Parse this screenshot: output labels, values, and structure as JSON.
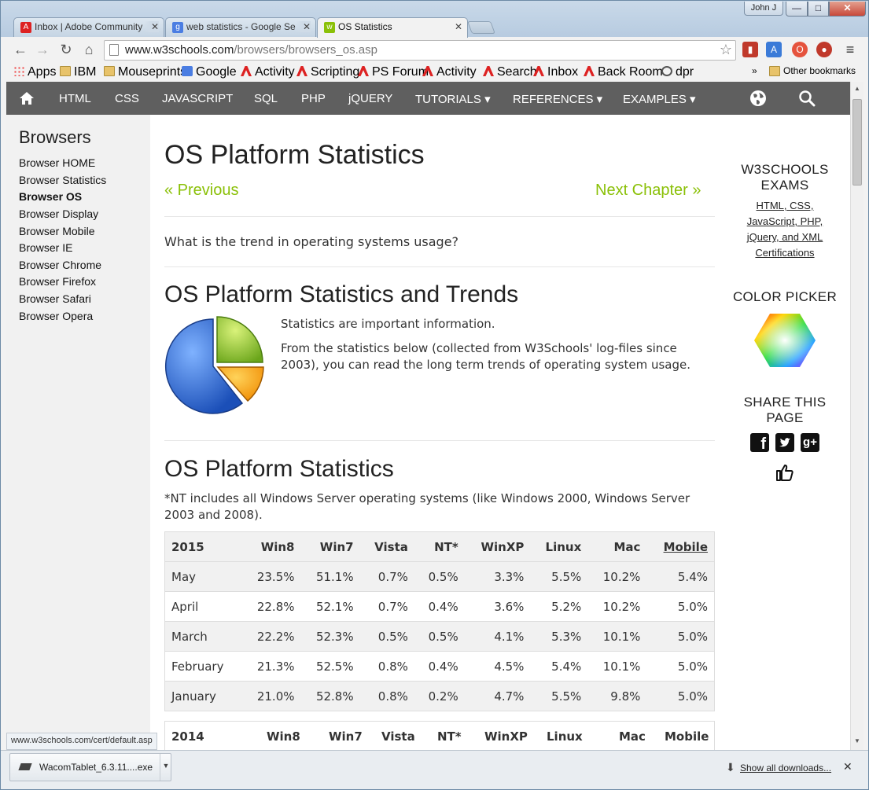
{
  "window": {
    "user": "John J",
    "min": "—",
    "max": "□",
    "close": "✕"
  },
  "tabs": [
    {
      "title": "Inbox | Adobe Community",
      "icon": "adobe-icon"
    },
    {
      "title": "web statistics - Google Se",
      "icon": "google-icon"
    },
    {
      "title": "OS Statistics",
      "icon": "w3schools-icon"
    }
  ],
  "address": {
    "host": "www.w3schools.com",
    "path": "/browsers/browsers_os.asp"
  },
  "bookmarks": [
    {
      "label": "Apps",
      "icon": "apps"
    },
    {
      "label": "IBM",
      "icon": "folder"
    },
    {
      "label": "Mouseprints",
      "icon": "folder"
    },
    {
      "label": "Google",
      "icon": "goog"
    },
    {
      "label": "Activity",
      "icon": "adobe"
    },
    {
      "label": "Scripting",
      "icon": "adobe"
    },
    {
      "label": "PS Forum",
      "icon": "adobe"
    },
    {
      "label": "Activity",
      "icon": "adobe"
    },
    {
      "label": "Search",
      "icon": "adobe"
    },
    {
      "label": "Inbox",
      "icon": "adobe"
    },
    {
      "label": "Back Room",
      "icon": "adobe"
    },
    {
      "label": "dpr",
      "icon": "dpr"
    }
  ],
  "bookmarks_more": "»",
  "other_bookmarks": "Other bookmarks",
  "nav": {
    "items": [
      "HTML",
      "CSS",
      "JAVASCRIPT",
      "SQL",
      "PHP",
      "jQUERY",
      "TUTORIALS ▾",
      "REFERENCES ▾",
      "EXAMPLES ▾"
    ]
  },
  "sidebar": {
    "title": "Browsers",
    "links": [
      "Browser HOME",
      "Browser Statistics",
      "Browser OS",
      "Browser Display",
      "Browser Mobile",
      "Browser IE",
      "Browser Chrome",
      "Browser Firefox",
      "Browser Safari",
      "Browser Opera"
    ],
    "current": "Browser OS"
  },
  "main": {
    "title": "OS Platform Statistics",
    "prev": "« Previous",
    "next": "Next Chapter »",
    "question": "What is the trend in operating systems usage?",
    "trends_heading": "OS Platform Statistics and Trends",
    "intro1": "Statistics are important information.",
    "intro2a": "From the statistics below (collected from W3Schools' log-files since",
    "intro2b": "2003), you can read the long term trends of operating system usage.",
    "stats_heading": "OS Platform Statistics",
    "note_a": "*NT includes all Windows Server operating systems (like Windows 2000, Windows Server",
    "note_b": "2003 and 2008).",
    "table": {
      "headers": [
        "2015",
        "Win8",
        "Win7",
        "Vista",
        "NT*",
        "WinXP",
        "Linux",
        "Mac",
        "Mobile"
      ],
      "rows": [
        [
          "May",
          "23.5%",
          "51.1%",
          "0.7%",
          "0.5%",
          "3.3%",
          "5.5%",
          "10.2%",
          "5.4%"
        ],
        [
          "April",
          "22.8%",
          "52.1%",
          "0.7%",
          "0.4%",
          "3.6%",
          "5.2%",
          "10.2%",
          "5.0%"
        ],
        [
          "March",
          "22.2%",
          "52.3%",
          "0.5%",
          "0.5%",
          "4.1%",
          "5.3%",
          "10.1%",
          "5.0%"
        ],
        [
          "February",
          "21.3%",
          "52.5%",
          "0.8%",
          "0.4%",
          "4.5%",
          "5.4%",
          "10.1%",
          "5.0%"
        ],
        [
          "January",
          "21.0%",
          "52.8%",
          "0.8%",
          "0.2%",
          "4.7%",
          "5.5%",
          "9.8%",
          "5.0%"
        ]
      ]
    },
    "table2_headers": [
      "2014",
      "Win8",
      "Win7",
      "Vista",
      "NT*",
      "WinXP",
      "Linux",
      "Mac",
      "Mobile"
    ]
  },
  "right": {
    "exams_title_1": "W3SCHOOLS",
    "exams_title_2": "EXAMS",
    "exams_links": [
      "HTML, CSS,",
      "JavaScript, PHP,",
      "jQuery, and XML",
      "Certifications"
    ],
    "color_picker": "COLOR PICKER",
    "share_1": "SHARE THIS",
    "share_2": "PAGE"
  },
  "status_url": "www.w3schools.com/cert/default.asp",
  "download": {
    "file": "WacomTablet_6.3.11....exe",
    "show_all": "Show all downloads..."
  },
  "colors": {
    "accent_green": "#8ac007",
    "nav_bg": "#5f5f5f"
  }
}
